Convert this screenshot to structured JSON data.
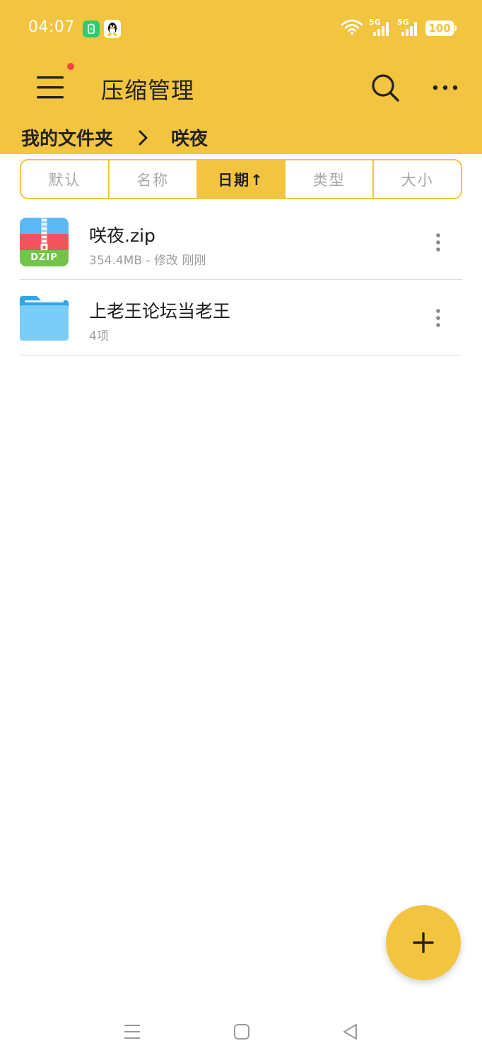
{
  "status_bar": {
    "time": "04:07",
    "battery": "100",
    "network_1": "5G",
    "network_2": "5G"
  },
  "app_bar": {
    "title": "压缩管理"
  },
  "breadcrumb": {
    "root": "我的文件夹",
    "current": "咲夜"
  },
  "sort_tabs": [
    {
      "label": "默认",
      "active": false
    },
    {
      "label": "名称",
      "active": false
    },
    {
      "label": "日期↑",
      "active": true
    },
    {
      "label": "类型",
      "active": false
    },
    {
      "label": "大小",
      "active": false
    }
  ],
  "files": [
    {
      "name": "咲夜.zip",
      "meta": "354.4MB - 修改 刚刚",
      "icon": "zip-archive-icon",
      "icon_label": "DZIP"
    },
    {
      "name": "上老王论坛当老王",
      "meta": "4项",
      "icon": "folder-icon"
    }
  ],
  "colors": {
    "accent": "#F2C440",
    "text_primary": "#222222",
    "text_secondary": "#9E9E9E",
    "notification_dot": "#F5453A",
    "folder": "#6DC8F5"
  }
}
